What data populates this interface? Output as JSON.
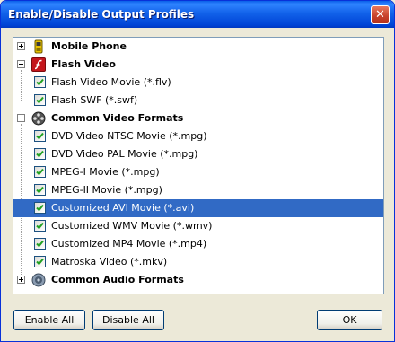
{
  "window": {
    "title": "Enable/Disable Output Profiles"
  },
  "tree": {
    "groups": [
      {
        "label": "Mobile Phone",
        "expanded": false,
        "icon": "mobile-phone-icon"
      },
      {
        "label": "Flash Video",
        "expanded": true,
        "icon": "flash-icon",
        "items": [
          {
            "label": "Flash Video Movie (*.flv)",
            "checked": true
          },
          {
            "label": "Flash SWF (*.swf)",
            "checked": true
          }
        ]
      },
      {
        "label": "Common Video Formats",
        "expanded": true,
        "icon": "film-reel-icon",
        "items": [
          {
            "label": "DVD Video NTSC Movie (*.mpg)",
            "checked": true
          },
          {
            "label": "DVD Video PAL Movie (*.mpg)",
            "checked": true
          },
          {
            "label": "MPEG-I Movie (*.mpg)",
            "checked": true
          },
          {
            "label": "MPEG-II Movie (*.mpg)",
            "checked": true
          },
          {
            "label": "Customized AVI Movie (*.avi)",
            "checked": true,
            "selected": true
          },
          {
            "label": "Customized WMV Movie (*.wmv)",
            "checked": true
          },
          {
            "label": "Customized MP4 Movie (*.mp4)",
            "checked": true
          },
          {
            "label": "Matroska Video (*.mkv)",
            "checked": true
          }
        ]
      },
      {
        "label": "Common Audio Formats",
        "expanded": false,
        "icon": "speaker-icon"
      }
    ]
  },
  "buttons": {
    "enable_all": "Enable All",
    "disable_all": "Disable All",
    "ok": "OK"
  },
  "colors": {
    "selection": "#316ac5",
    "checkmark": "#21a121",
    "titlebar": "#0a5fe8"
  }
}
